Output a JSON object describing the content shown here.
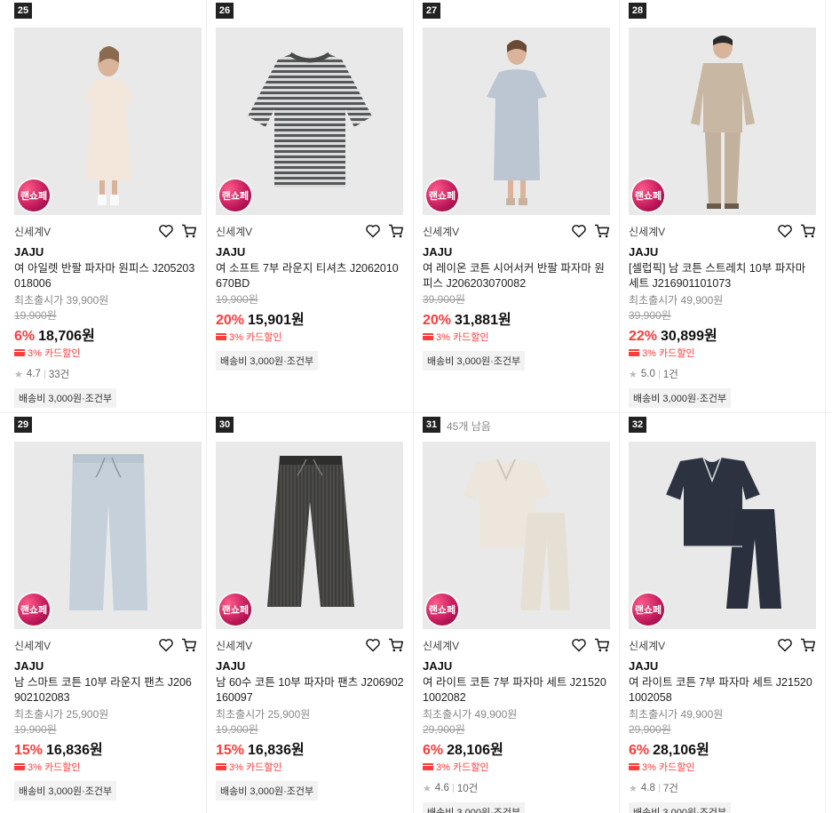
{
  "products": [
    {
      "rank": "25",
      "seller": "신세계V",
      "brand": "JAJU",
      "title": "여 아일렛 반팔 파자마 원피스 J205203018006",
      "orig_label": "최초출시가 39,900원",
      "strike": "19,900원",
      "discount": "6%",
      "price": "18,706원",
      "card_sale": "3% 카드할인",
      "rating": "4.7",
      "reviews": "33건",
      "shipping": "배송비 3,000원·조건부",
      "badge": "랜쇼페",
      "image": "dress-cream"
    },
    {
      "rank": "26",
      "seller": "신세계V",
      "brand": "JAJU",
      "title": "여 소프트 7부 라운지 티셔츠 J2062010670BD",
      "orig_label": "",
      "strike": "19,900원",
      "discount": "20%",
      "price": "15,901원",
      "card_sale": "3% 카드할인",
      "rating": "",
      "reviews": "",
      "shipping": "배송비 3,000원·조건부",
      "badge": "랜쇼페",
      "image": "striped-tee"
    },
    {
      "rank": "27",
      "seller": "신세계V",
      "brand": "JAJU",
      "title": "여 레이온 코튼 시어서커 반팔 파자마 원피스 J206203070082",
      "orig_label": "",
      "strike": "39,900원",
      "discount": "20%",
      "price": "31,881원",
      "card_sale": "3% 카드할인",
      "rating": "",
      "reviews": "",
      "shipping": "배송비 3,000원·조건부",
      "badge": "랜쇼페",
      "image": "dress-blue"
    },
    {
      "rank": "28",
      "seller": "신세계V",
      "brand": "JAJU",
      "title": "[셀럽픽] 남 코튼 스트레치 10부 파자마 세트 J216901101073",
      "orig_label": "최초출시가 49,900원",
      "strike": "39,900원",
      "discount": "22%",
      "price": "30,899원",
      "card_sale": "3% 카드할인",
      "rating": "5.0",
      "reviews": "1건",
      "shipping": "배송비 3,000원·조건부",
      "badge": "랜쇼페",
      "image": "men-pajama-beige"
    },
    {
      "rank": "29",
      "seller": "신세계V",
      "brand": "JAJU",
      "title": "남 스마트 코튼 10부 라운지 팬츠 J206902102083",
      "orig_label": "최초출시가 25,900원",
      "strike": "19,900원",
      "discount": "15%",
      "price": "16,836원",
      "card_sale": "3% 카드할인",
      "rating": "",
      "reviews": "",
      "shipping": "배송비 3,000원·조건부",
      "badge": "랜쇼페",
      "image": "pants-lightblue"
    },
    {
      "rank": "30",
      "seller": "신세계V",
      "brand": "JAJU",
      "title": "남 60수 코튼 10부 파자마 팬츠 J206902160097",
      "orig_label": "최초출시가 25,900원",
      "strike": "19,900원",
      "discount": "15%",
      "price": "16,836원",
      "card_sale": "3% 카드할인",
      "rating": "",
      "reviews": "",
      "shipping": "배송비 3,000원·조건부",
      "badge": "랜쇼페",
      "image": "pants-dark"
    },
    {
      "rank": "31",
      "remain": "45개 남음",
      "seller": "신세계V",
      "brand": "JAJU",
      "title": "여 라이트 코튼 7부 파자마 세트 J215201002082",
      "orig_label": "최초출시가 49,900원",
      "strike": "29,900원",
      "discount": "6%",
      "price": "28,106원",
      "card_sale": "3% 카드할인",
      "rating": "4.6",
      "reviews": "10건",
      "shipping": "배송비 3,000원·조건부",
      "badge": "랜쇼페",
      "image": "set-beige"
    },
    {
      "rank": "32",
      "seller": "신세계V",
      "brand": "JAJU",
      "title": "여 라이트 코튼 7부 파자마 세트 J215201002058",
      "orig_label": "최초출시가 49,900원",
      "strike": "29,900원",
      "discount": "6%",
      "price": "28,106원",
      "card_sale": "3% 카드할인",
      "rating": "4.8",
      "reviews": "7건",
      "shipping": "배송비 3,000원·조건부",
      "badge": "랜쇼페",
      "image": "set-navy"
    }
  ],
  "icons": {
    "wishlist": "heart-icon",
    "cart": "cart-icon",
    "star": "star-icon",
    "card": "card-icon"
  },
  "colors": {
    "discount": "#ff3b3b",
    "rank_bg": "#222222",
    "badge": "#c0185a"
  }
}
